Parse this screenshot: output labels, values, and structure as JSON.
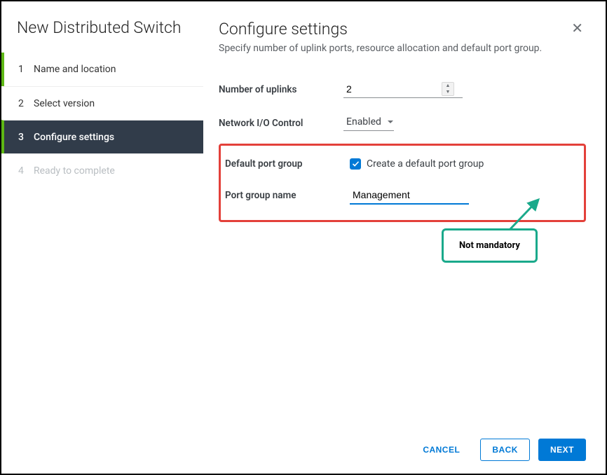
{
  "sidebar": {
    "title": "New Distributed Switch",
    "steps": [
      {
        "num": "1",
        "label": "Name and location"
      },
      {
        "num": "2",
        "label": "Select version"
      },
      {
        "num": "3",
        "label": "Configure settings"
      },
      {
        "num": "4",
        "label": "Ready to complete"
      }
    ]
  },
  "header": {
    "title": "Configure settings",
    "subtitle": "Specify number of uplink ports, resource allocation and default port group."
  },
  "form": {
    "uplinks_label": "Number of uplinks",
    "uplinks_value": "2",
    "nioc_label": "Network I/O Control",
    "nioc_value": "Enabled",
    "default_pg_label": "Default port group",
    "default_pg_checkbox_label": "Create a default port group",
    "pg_name_label": "Port group name",
    "pg_name_value": "Management"
  },
  "callout": {
    "text": "Not mandatory"
  },
  "footer": {
    "cancel": "CANCEL",
    "back": "BACK",
    "next": "NEXT"
  }
}
